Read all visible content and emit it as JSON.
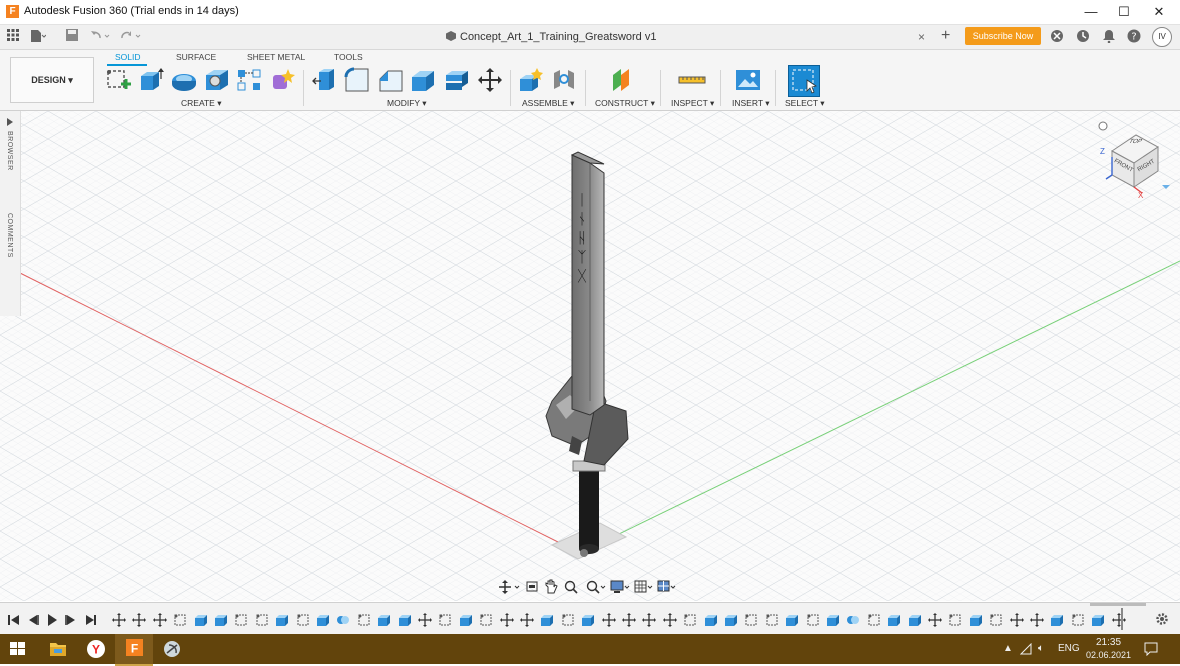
{
  "window": {
    "logo_letter": "F",
    "title": "Autodesk Fusion 360 (Trial ends in 14 days)",
    "minimize": "—",
    "maximize": "☐",
    "close": "✕"
  },
  "tabbar": {
    "document_title": "Concept_Art_1_Training_Greatsword v1",
    "close_tab": "×",
    "new_tab": "+",
    "subscribe_label": "Subscribe Now",
    "avatar_initials": "IV"
  },
  "toolbar": {
    "workspace_label": "DESIGN ▾",
    "tabs": [
      "SOLID",
      "SURFACE",
      "SHEET METAL",
      "TOOLS"
    ],
    "active_tab": "SOLID",
    "groups": {
      "create": "CREATE ▾",
      "modify": "MODIFY ▾",
      "assemble": "ASSEMBLE ▾",
      "construct": "CONSTRUCT ▾",
      "inspect": "INSPECT ▾",
      "insert": "INSERT ▾",
      "select": "SELECT ▾"
    },
    "accent_color": "#0696d7"
  },
  "side_panel": {
    "browser_label": "BROWSER",
    "comments_label": "COMMENTS"
  },
  "viewcube": {
    "top": "TOP",
    "front": "FRONT",
    "right": "RIGHT",
    "z": "Z",
    "x": "X"
  },
  "model": {
    "runes": "ᛁ ᚾ ᚺ ᛉ ᚷ"
  },
  "taskbar": {
    "language": "ENG",
    "time": "21:35",
    "date": "02.06.2021"
  }
}
